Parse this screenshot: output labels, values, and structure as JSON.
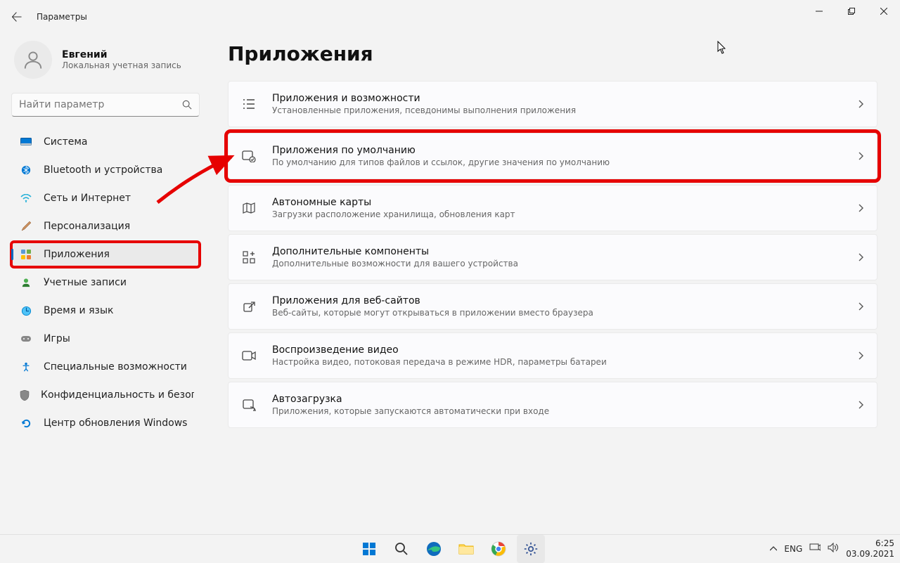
{
  "window": {
    "title": "Параметры"
  },
  "user": {
    "name": "Евгений",
    "subtitle": "Локальная учетная запись"
  },
  "search": {
    "placeholder": "Найти параметр"
  },
  "nav": {
    "items": [
      {
        "label": "Система"
      },
      {
        "label": "Bluetooth и устройства"
      },
      {
        "label": "Сеть и Интернет"
      },
      {
        "label": "Персонализация"
      },
      {
        "label": "Приложения"
      },
      {
        "label": "Учетные записи"
      },
      {
        "label": "Время и язык"
      },
      {
        "label": "Игры"
      },
      {
        "label": "Специальные возможности"
      },
      {
        "label": "Конфиденциальность и безопасность"
      },
      {
        "label": "Центр обновления Windows"
      }
    ]
  },
  "page": {
    "title": "Приложения"
  },
  "cards": [
    {
      "title": "Приложения и возможности",
      "subtitle": "Установленные приложения, псевдонимы выполнения приложения"
    },
    {
      "title": "Приложения по умолчанию",
      "subtitle": "По умолчанию для типов файлов и ссылок, другие значения по умолчанию"
    },
    {
      "title": "Автономные карты",
      "subtitle": "Загрузки расположение хранилища, обновления карт"
    },
    {
      "title": "Дополнительные компоненты",
      "subtitle": "Дополнительные возможности для вашего устройства"
    },
    {
      "title": "Приложения для веб-сайтов",
      "subtitle": "Веб-сайты, которые могут открываться в приложении вместо браузера"
    },
    {
      "title": "Воспроизведение видео",
      "subtitle": "Настройка видео, потоковая передача в режиме HDR, параметры батареи"
    },
    {
      "title": "Автозагрузка",
      "subtitle": "Приложения, которые запускаются автоматически при входе"
    }
  ],
  "tray": {
    "lang": "ENG",
    "time": "6:25",
    "date": "03.09.2021"
  }
}
